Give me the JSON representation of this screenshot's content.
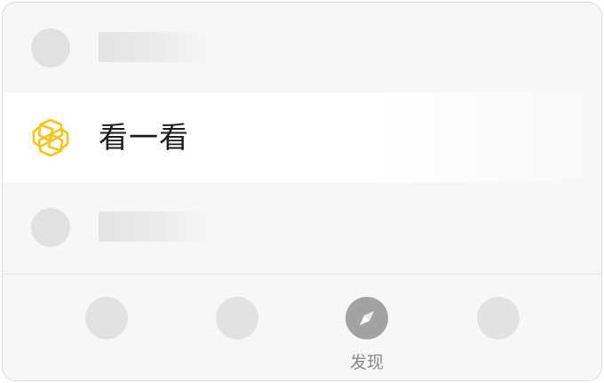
{
  "list": {
    "feature_item": {
      "label": "看一看",
      "icon": "moments-star-icon",
      "icon_color": "#F5C518"
    }
  },
  "tabbar": {
    "active_tab": {
      "label": "发现",
      "icon": "compass-icon",
      "icon_color": "#A2A2A2"
    }
  }
}
